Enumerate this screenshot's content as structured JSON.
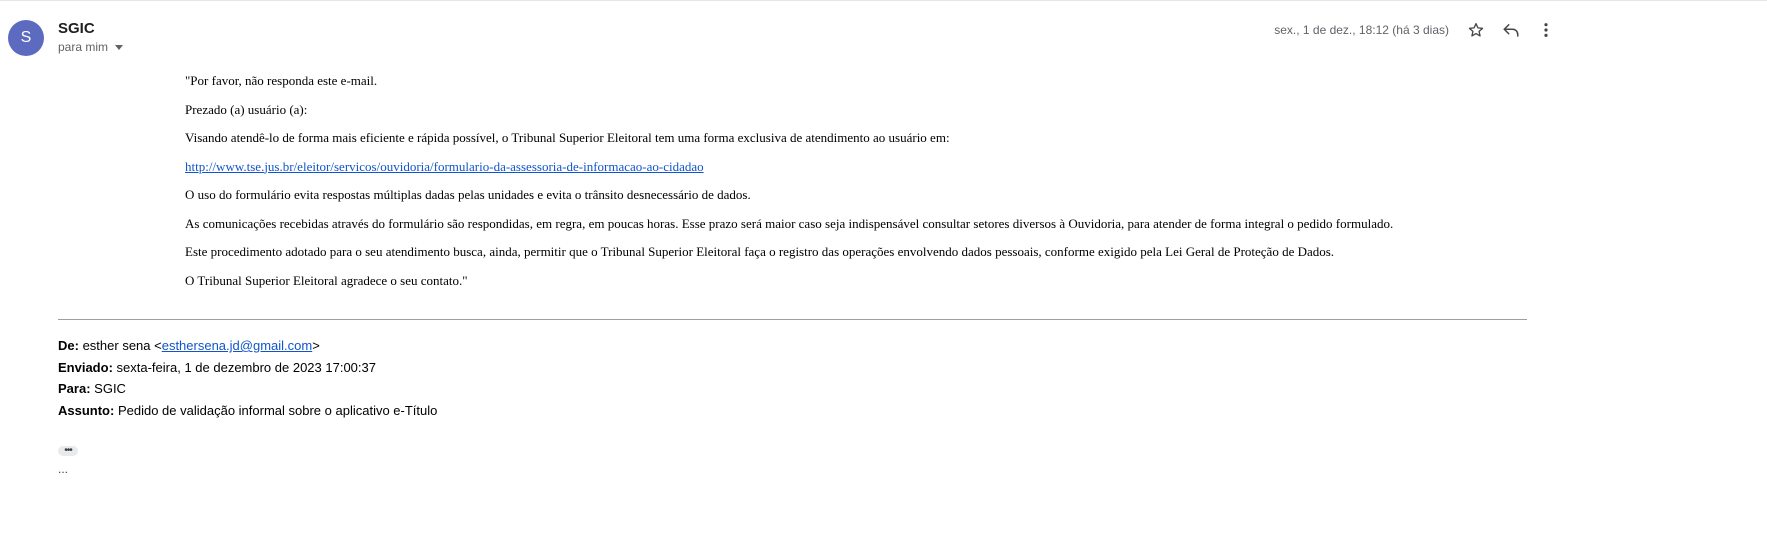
{
  "header": {
    "avatar_initial": "S",
    "avatar_color": "#5c6bc0",
    "sender": "SGIC",
    "recipient": "para mim",
    "date": "sex., 1 de dez., 18:12 (há 3 dias)",
    "icons": [
      "star-icon",
      "reply-icon",
      "more-vert-icon"
    ]
  },
  "body": {
    "paragraphs": [
      "\"Por favor, não responda este e-mail.",
      "Prezado (a) usuário (a):",
      "Visando atendê-lo de forma mais eficiente e rápida possível, o Tribunal Superior Eleitoral tem uma forma exclusiva de atendimento ao usuário em:",
      "http://www.tse.jus.br/eleitor/servicos/ouvidoria/formulario-da-assessoria-de-informacao-ao-cidadao",
      "O uso do formulário evita respostas múltiplas dadas pelas unidades e evita o trânsito desnecessário de dados.",
      "As comunicações recebidas através do formulário são respondidas, em regra, em poucas horas. Esse prazo será maior caso seja indispensável consultar setores diversos à Ouvidoria, para atender de forma integral o pedido formulado.",
      "Este procedimento adotado para o seu atendimento busca, ainda, permitir que o Tribunal Superior Eleitoral faça o registro das operações envolvendo dados pessoais, conforme exigido pela Lei Geral de Proteção de Dados.",
      "O Tribunal Superior Eleitoral agradece o seu contato.\""
    ]
  },
  "quoted": {
    "from_label": "De:",
    "from_name": "esther sena <",
    "from_email": "esthersena.jd@gmail.com",
    "from_close": ">",
    "sent_label": "Enviado:",
    "sent_value": "sexta-feira, 1 de dezembro de 2023 17:00:37",
    "to_label": "Para:",
    "to_value": "SGIC",
    "subject_label": "Assunto:",
    "subject_value": "Pedido de validação informal sobre o aplicativo e-Título"
  },
  "trimmed": {
    "button_label": "•••",
    "dots": "..."
  }
}
